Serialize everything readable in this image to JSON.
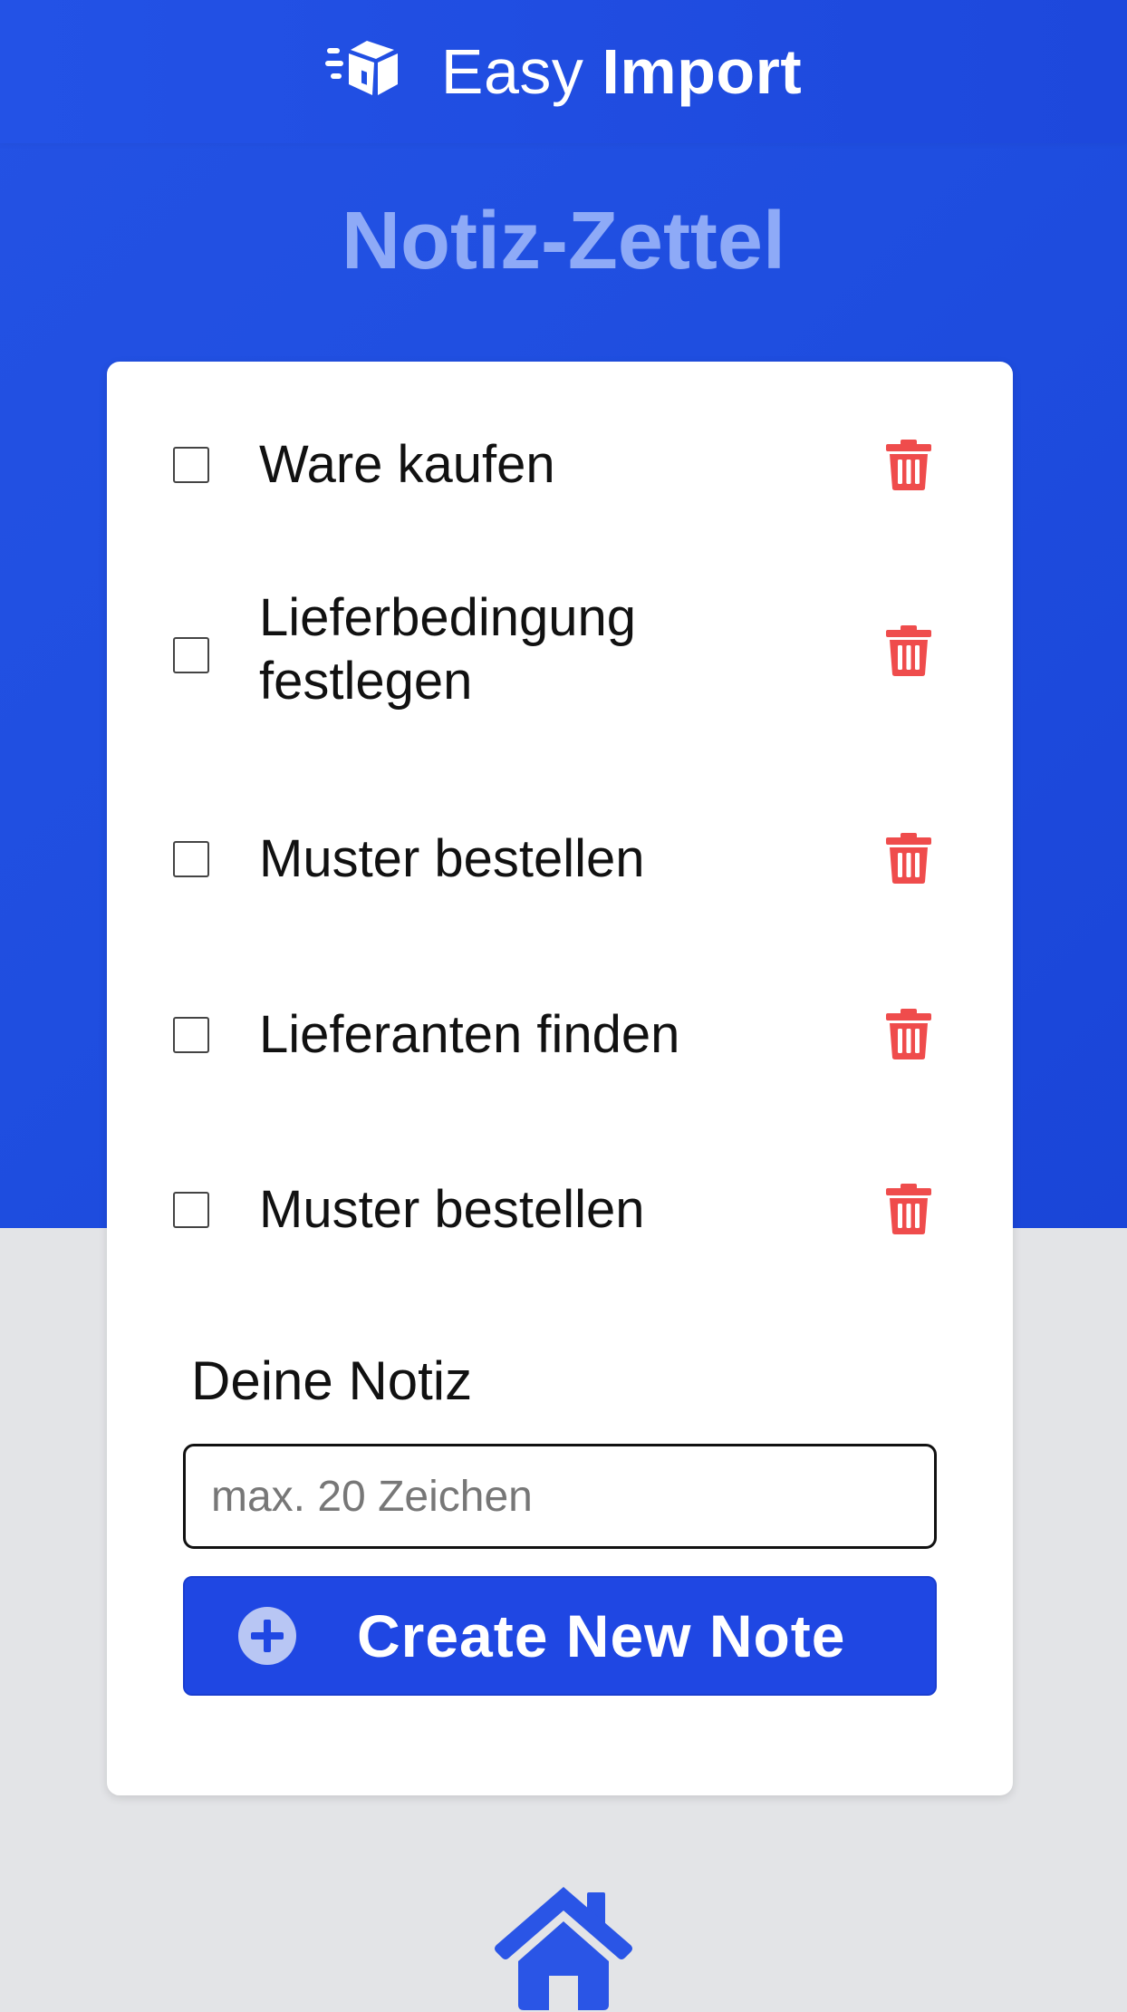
{
  "header": {
    "brand_easy": "Easy",
    "brand_import": "Import",
    "logo_icon": "flying-box-icon"
  },
  "page": {
    "title": "Notiz-Zettel"
  },
  "notes": [
    {
      "text": "Ware kaufen",
      "checked": false
    },
    {
      "text": "Lieferbedingung festlegen",
      "checked": false
    },
    {
      "text": "Muster bestellen",
      "checked": false
    },
    {
      "text": "Lieferanten finden",
      "checked": false
    },
    {
      "text": "Muster bestellen",
      "checked": false
    }
  ],
  "form": {
    "label": "Deine Notiz",
    "placeholder": "max. 20 Zeichen",
    "value": "",
    "submit_label": "Create New Note",
    "submit_icon": "plus-circle-icon"
  },
  "footer": {
    "home_icon": "home-icon"
  },
  "colors": {
    "brand_blue": "#1f47e3",
    "title_blue": "#8eaaf7",
    "delete_red": "#ef4c4c",
    "background_gray": "#e3e4e7"
  }
}
